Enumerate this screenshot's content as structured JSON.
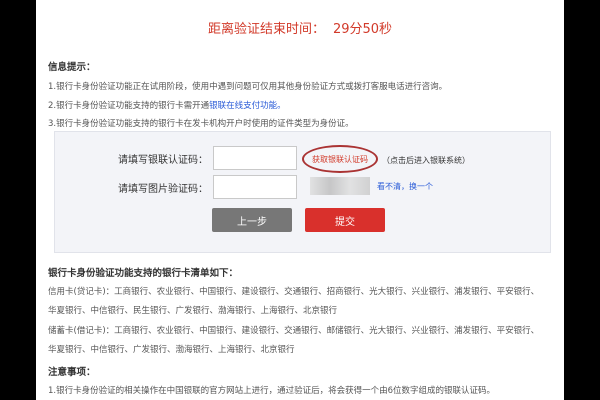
{
  "countdown": {
    "label": "距离验证结束时间：",
    "value": "29分50秒"
  },
  "info": {
    "title": "信息提示：",
    "lines": [
      {
        "text": "1.银行卡身份验证功能正在试用阶段，使用中遇到问题可仅用其他身份验证方式或拨打客服电话进行咨询。",
        "link": ""
      },
      {
        "text": "2.银行卡身份验证功能支持的银行卡需开通",
        "link": "银联在线支付功能。"
      },
      {
        "text": "3.银行卡身份验证功能支持的银行卡在发卡机构开户时使用的证件类型为身份证。",
        "link": ""
      }
    ]
  },
  "form": {
    "sms_label": "请填写银联认证码：",
    "sms_button": "获取银联认证码",
    "sms_hint": "（点击后进入银联系统）",
    "captcha_label": "请填写图片验证码：",
    "refresh_link": "看不清，换一个",
    "prev_button": "上一步",
    "submit_button": "提交"
  },
  "banks": {
    "title": "银行卡身份验证功能支持的银行卡清单如下：",
    "credit_row1": "信用卡(贷记卡)：工商银行、农业银行、中国银行、建设银行、交通银行、招商银行、光大银行、兴业银行、浦发银行、平安银行、",
    "credit_row2": "华夏银行、中信银行、民生银行、广发银行、渤海银行、上海银行、北京银行",
    "debit_row1": "储蓄卡(借记卡)：工商银行、农业银行、中国银行、建设银行、交通银行、邮储银行、光大银行、兴业银行、浦发银行、平安银行、",
    "debit_row2": "华夏银行、中信银行、广发银行、渤海银行、上海银行、北京银行"
  },
  "notes": {
    "title": "注意事项：",
    "line1": "1.银行卡身份验证的相关操作在中国银联的官方网站上进行，通过验证后，将会获得一个由6位数字组成的银联认证码。"
  }
}
